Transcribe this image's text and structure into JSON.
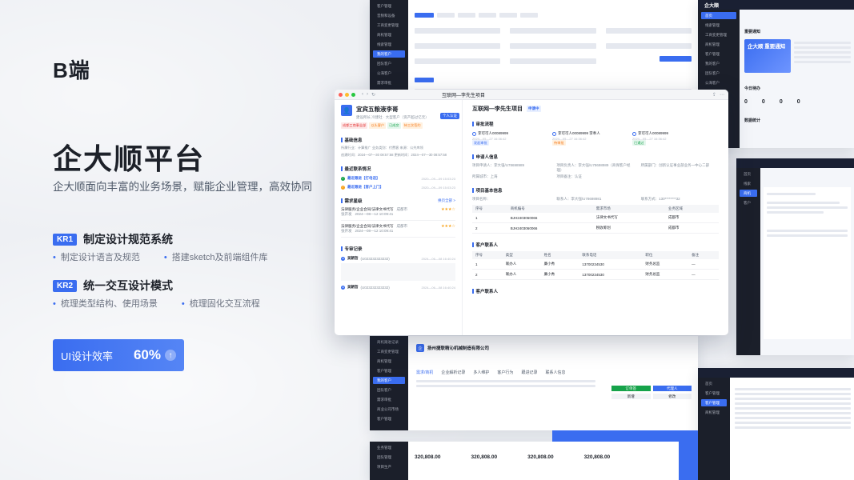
{
  "hero": {
    "brand_tag": "B端",
    "title": "企大顺平台",
    "description": "企大顺面向丰富的业务场景，赋能企业管理，高效协同"
  },
  "kr1": {
    "badge": "KR1",
    "title": "制定设计规范系统",
    "points": [
      "制定设计语言及规范",
      "搭建sketch及前端组件库"
    ]
  },
  "kr2": {
    "badge": "KR2",
    "title": "统一交互设计模式",
    "points": [
      "梳理类型结构、使用场景",
      "梳理固化交互流程"
    ]
  },
  "efficiency": {
    "label": "UI设计效率",
    "value": "60%",
    "arrow": "↑"
  },
  "window": {
    "tab_title": "互联网—李先生项目",
    "customer": {
      "name": "宜宾五粮液李哥",
      "sub": "建设所长  冷建社 ·  大型客户（资产超过亿元）",
      "tags": [
        "成都工商事业部",
        "以头客户",
        "已成交",
        "待三次签约"
      ],
      "self_badge": "个人认证"
    },
    "basic_info": {
      "title": "基础信息",
      "rows": [
        "所属行业：计算推广  业务类别：付费客  来源：公共库领",
        "创建时间：2024—07—30 08:57:58  更新时间：2024—07—30 08:57:58"
      ]
    },
    "recent": {
      "title": "最近联系情况",
      "items": [
        {
          "label": "最近跟进【打电话】",
          "date": "2020—09—09 15:03:23"
        },
        {
          "label": "最近跟进【客户上门】",
          "date": "2020—09—09 15:03:23"
        }
      ]
    },
    "requirements": {
      "title": "需求星级",
      "more": "换页全部 >",
      "items": [
        {
          "name": "法律服务/企业合同/法律文书代写",
          "city": "成都市",
          "person": "张开发",
          "date": "2024—08—12 10:09:41"
        },
        {
          "name": "法律服务/企业合同/法律文书代写",
          "city": "成都市",
          "person": "张开发",
          "date": "2024—08—12 10:09:41"
        }
      ]
    },
    "records": {
      "title": "专审记录",
      "items": [
        {
          "name": "吴朝哲",
          "code": "(U023232323232)",
          "date": "2024—06—08 16:40:24"
        },
        {
          "name": "吴朝哲",
          "code": "(U023232323232)",
          "date": "2024—06—08 16:40:24"
        }
      ]
    },
    "project": {
      "title": "互联网—李先生项目",
      "status": "申请中",
      "audit_title": "审批流程",
      "flow": [
        {
          "name": "李可可人00089999",
          "date": "2024—05—27 16:36:42",
          "tag": "发起审批"
        },
        {
          "name": "李可可人00089999  李奉人",
          "date": "2024—05—27 16:36:42",
          "tag": "待审批"
        },
        {
          "name": "李可可人00089999",
          "date": "2024—05—27 16:36:42",
          "tag": "已通过"
        }
      ],
      "apply_title": "申请人信息",
      "apply": [
        "项目申请人：李大强/U78698989",
        "项目负责人：李大强/U78698989（商保客户经理）",
        "所属部门：创新认证事业部业务一中心二部",
        "所属城市：上海",
        "项目备注：认证",
        ""
      ],
      "base_title": "项目基本信息",
      "base": [
        "项目名称：",
        "联系人：李大强/U78698981",
        "联系方式：130********32"
      ],
      "table_head": [
        "序号",
        "商机编号",
        "需求市场",
        "业务区域"
      ],
      "table_rows": [
        [
          "1",
          "BJH2403060066",
          "法律文书代写",
          "成都市"
        ],
        [
          "2",
          "BJH2403060066",
          "税收筹划",
          "成都市"
        ]
      ],
      "contact_title": "客户联系人",
      "contact_head": [
        "序号",
        "类型",
        "姓名",
        "联系电话",
        "职位",
        "备注"
      ],
      "contact_rows": [
        [
          "1",
          "联办人",
          "廉小秀",
          "13700234530",
          "财务总监",
          "—"
        ],
        [
          "2",
          "联办人",
          "廉小秀",
          "13700234530",
          "财务总监",
          "—"
        ]
      ],
      "members_title": "客户联系人"
    }
  },
  "bottom_stats": {
    "values": [
      "320,808.00",
      "320,808.00",
      "320,808.00",
      "320,808.00"
    ]
  },
  "company_screen": {
    "name": "扬州捷联精沁机械制造有限公司",
    "tabs": [
      "需求/商机",
      "企业解析记录",
      "多人维护",
      "客户行为",
      "跟进记录",
      "联系人信息"
    ],
    "buttons": [
      "订单签",
      "代理人",
      "新增",
      "修改"
    ]
  },
  "right_screen": {
    "brand": "企大顺",
    "notice_title": "重要通知",
    "notice_banner": "企大顺 重要通知",
    "todo_title": "今日待办",
    "stats_title": "数据统计"
  }
}
